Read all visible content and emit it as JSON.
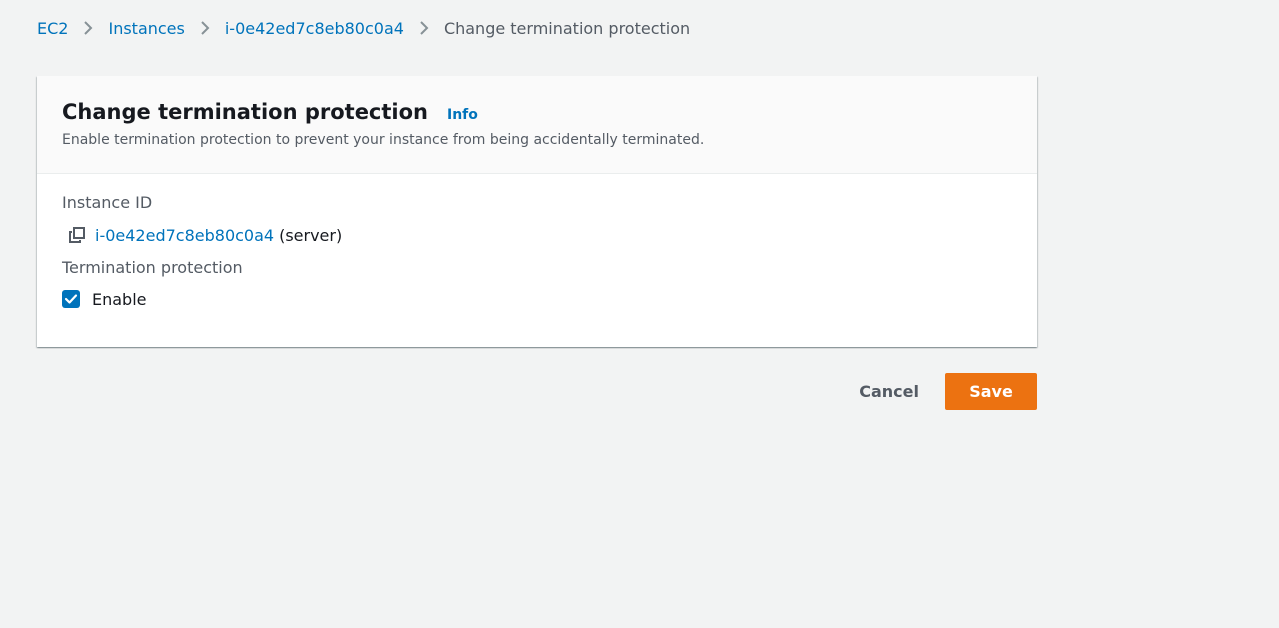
{
  "breadcrumb": {
    "items": [
      "EC2",
      "Instances",
      "i-0e42ed7c8eb80c0a4"
    ],
    "current": "Change termination protection"
  },
  "panel": {
    "title": "Change termination protection",
    "info_label": "Info",
    "description": "Enable termination protection to prevent your instance from being accidentally terminated."
  },
  "instance": {
    "label": "Instance ID",
    "id": "i-0e42ed7c8eb80c0a4",
    "suffix": "(server)"
  },
  "termination": {
    "label": "Termination protection",
    "checkbox_label": "Enable",
    "checked": true
  },
  "actions": {
    "cancel_label": "Cancel",
    "save_label": "Save"
  },
  "colors": {
    "link": "#0073bb",
    "primary_button": "#ec7211",
    "background": "#f2f3f3"
  },
  "icons": {
    "breadcrumb_separator": "chevron-right-icon",
    "copy": "copy-icon",
    "checkbox": "checkmark-icon"
  }
}
